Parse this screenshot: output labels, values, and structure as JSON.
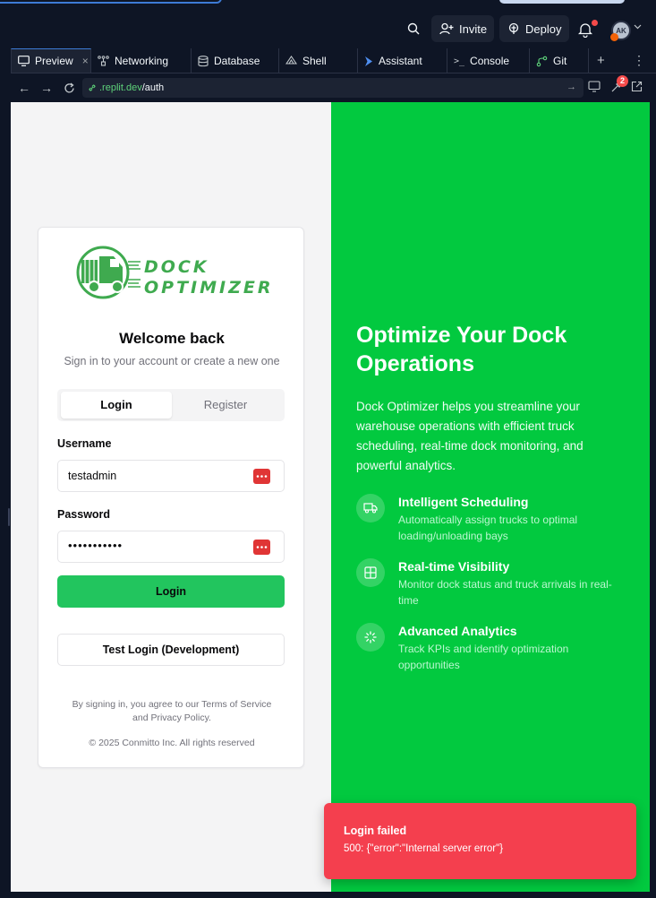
{
  "topbar": {
    "invite_label": "Invite",
    "deploy_label": "Deploy",
    "avatar_initials": "AK"
  },
  "tabs": [
    {
      "label": "Preview",
      "icon": "monitor-icon",
      "active": true
    },
    {
      "label": "Networking",
      "icon": "network-icon"
    },
    {
      "label": "Database",
      "icon": "database-icon"
    },
    {
      "label": "Shell",
      "icon": "shell-icon"
    },
    {
      "label": "Assistant",
      "icon": "assistant-icon"
    },
    {
      "label": "Console",
      "icon": "console-icon"
    },
    {
      "label": "Git",
      "icon": "git-icon"
    }
  ],
  "tabs_close": "×",
  "tabs_prompt_glyph": ">_",
  "urlbar": {
    "host": ".replit.dev",
    "path": "/auth",
    "devtools_badge": "2"
  },
  "auth": {
    "logo_line1": "DOCK",
    "logo_line2": "OPTIMIZER",
    "title": "Welcome back",
    "subtitle": "Sign in to your account or create a new one",
    "tab_login": "Login",
    "tab_register": "Register",
    "username_label": "Username",
    "username_value": "testadmin",
    "password_label": "Password",
    "password_value": "•••••••••••",
    "login_button": "Login",
    "test_login_button": "Test Login (Development)",
    "terms_line1": "By signing in, you agree to our Terms of Service",
    "terms_line2": "and Privacy Policy.",
    "copyright": "© 2025 Conmitto Inc. All rights reserved"
  },
  "hero": {
    "title": "Optimize Your Dock Operations",
    "description": "Dock Optimizer helps you streamline your warehouse operations with efficient truck scheduling, real-time dock monitoring, and powerful analytics.",
    "features": [
      {
        "title": "Intelligent Scheduling",
        "desc": "Automatically assign trucks to optimal loading/unloading bays",
        "icon": "truck-icon"
      },
      {
        "title": "Real-time Visibility",
        "desc": "Monitor dock status and truck arrivals in real-time",
        "icon": "grid-icon"
      },
      {
        "title": "Advanced Analytics",
        "desc": "Track KPIs and identify optimization opportunities",
        "icon": "loader-icon"
      }
    ]
  },
  "toast": {
    "title": "Login failed",
    "message": "500: {\"error\":\"Internal server error\"}"
  },
  "colors": {
    "brand_green": "#02c93f",
    "button_green": "#22c55e",
    "toast_red": "#f43f4e",
    "ide_bg": "#0e1525"
  }
}
